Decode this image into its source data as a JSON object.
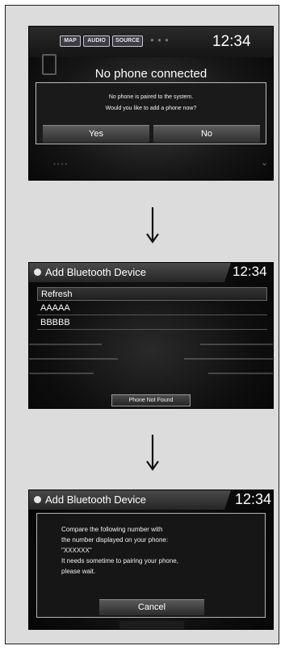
{
  "screen1": {
    "tabs": [
      "MAP",
      "AUDIO",
      "SOURCE"
    ],
    "time": "12:34",
    "title": "No phone connected",
    "dialog": {
      "message_line1": "No phone is paired to the system.",
      "message_line2": "Would you like to add a phone now?",
      "yes_label": "Yes",
      "no_label": "No"
    }
  },
  "screen2": {
    "header_title": "Add Bluetooth Device",
    "time": "12:34",
    "list": [
      "Refresh",
      "AAAAA",
      "BBBBB"
    ],
    "phone_not_found_label": "Phone Not Found"
  },
  "screen3": {
    "header_title": "Add Bluetooth Device",
    "time": "12:34",
    "message_lines": [
      "Compare the following number with",
      "the number displayed on your phone:",
      "\"XXXXXX\"",
      "It needs sometime to pairing your phone,",
      "please wait."
    ],
    "cancel_label": "Cancel"
  },
  "colors": {
    "frame_bg": "#dcdcdc",
    "screen_bg": "#0b0b0b",
    "text": "#ffffff"
  },
  "icons": [
    "phone-icon",
    "bluetooth-menu-icon",
    "chevron-down-icon",
    "arrow-down-icon"
  ]
}
